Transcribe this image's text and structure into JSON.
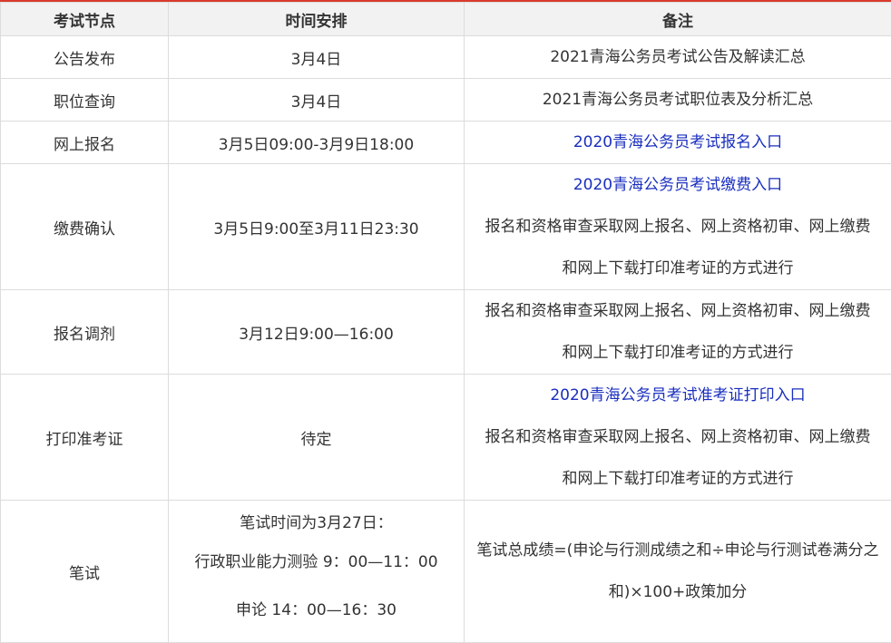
{
  "headers": [
    "考试节点",
    "时间安排",
    "备注"
  ],
  "colors": {
    "accent": "#d93a2b",
    "link": "#1a2fbf",
    "header_bg": "#f2f2f2",
    "border": "#dcdcdc"
  },
  "rows": [
    {
      "node": "公告发布",
      "time": "3月4日",
      "notes": [
        {
          "text": "2021青海公务员考试公告及解读汇总",
          "link": false
        }
      ]
    },
    {
      "node": "职位查询",
      "time": "3月4日",
      "notes": [
        {
          "text": "2021青海公务员考试职位表及分析汇总",
          "link": false
        }
      ]
    },
    {
      "node": "网上报名",
      "time": "3月5日09:00-3月9日18:00",
      "notes": [
        {
          "text": "2020青海公务员考试报名入口",
          "link": true
        }
      ]
    },
    {
      "node": "缴费确认",
      "time": "3月5日9:00至3月11日23:30",
      "notes": [
        {
          "text": "2020青海公务员考试缴费入口",
          "link": true
        },
        {
          "text": "报名和资格审查采取网上报名、网上资格初审、网上缴费",
          "link": false
        },
        {
          "text": "和网上下载打印准考证的方式进行",
          "link": false
        }
      ]
    },
    {
      "node": "报名调剂",
      "time": "3月12日9:00—16:00",
      "notes": [
        {
          "text": "报名和资格审查采取网上报名、网上资格初审、网上缴费",
          "link": false
        },
        {
          "text": "和网上下载打印准考证的方式进行",
          "link": false
        }
      ]
    },
    {
      "node": "打印准考证",
      "time": "待定",
      "notes": [
        {
          "text": "2020青海公务员考试准考证打印入口",
          "link": true
        },
        {
          "text": "报名和资格审查采取网上报名、网上资格初审、网上缴费",
          "link": false
        },
        {
          "text": "和网上下载打印准考证的方式进行",
          "link": false
        }
      ]
    }
  ],
  "written": {
    "node": "笔试",
    "time_lines": [
      "笔试时间为3月27日：",
      "行政职业能力测验 9：00—11：00",
      "申论 14：00—16：30"
    ],
    "note_lines": [
      "笔试总成绩=(申论与行测成绩之和÷申论与行测试卷满分之",
      "和)×100+政策加分"
    ]
  }
}
